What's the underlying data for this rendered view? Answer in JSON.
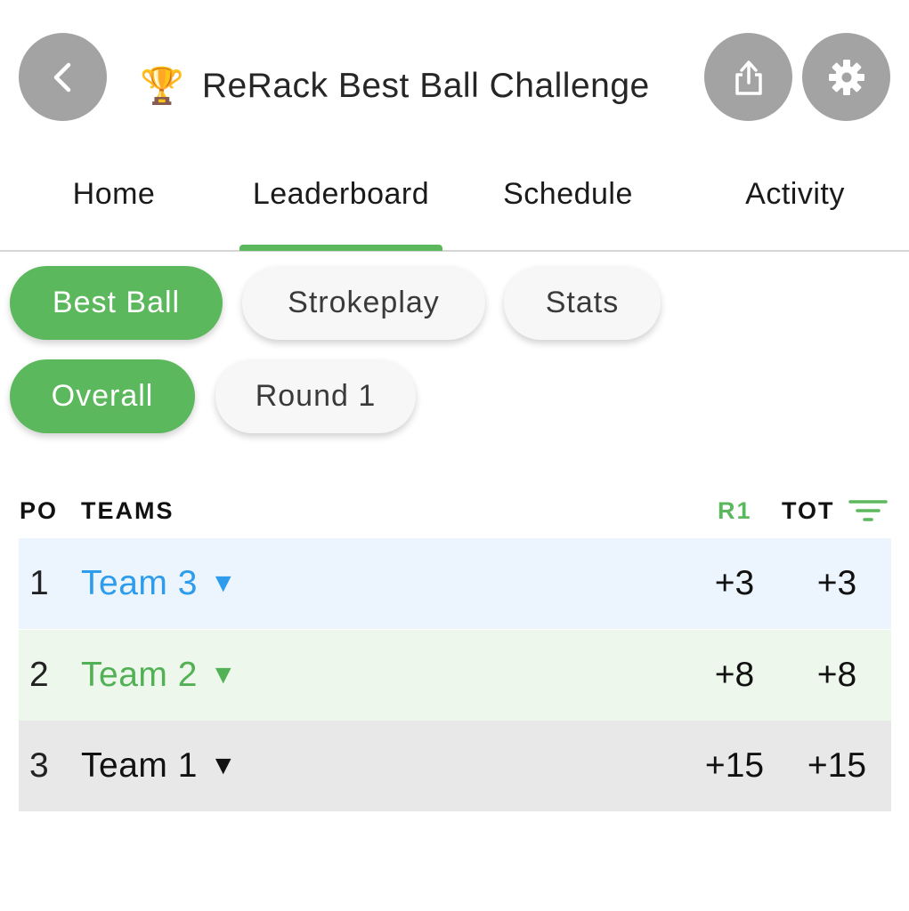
{
  "header": {
    "title": "ReRack Best Ball Challenge",
    "trophy_glyph": "🏆",
    "back_icon": "chevron-left-icon",
    "share_icon": "share-icon",
    "settings_icon": "gear-icon"
  },
  "tabs": [
    {
      "label": "Home",
      "active": false
    },
    {
      "label": "Leaderboard",
      "active": true
    },
    {
      "label": "Schedule",
      "active": false
    },
    {
      "label": "Activity",
      "active": false
    }
  ],
  "format_chips": [
    {
      "label": "Best Ball",
      "active": true
    },
    {
      "label": "Strokeplay",
      "active": false
    },
    {
      "label": "Stats",
      "active": false
    }
  ],
  "round_chips": [
    {
      "label": "Overall",
      "active": true
    },
    {
      "label": "Round 1",
      "active": false
    }
  ],
  "table": {
    "headers": {
      "position": "PO",
      "teams": "TEAMS",
      "round": "R1",
      "total": "TOT"
    },
    "rows": [
      {
        "position": "1",
        "team": "Team 3",
        "indicator": "▼",
        "r1": "+3",
        "total": "+3",
        "team_color": "#2d9cec",
        "row_color": "#ecf4fd"
      },
      {
        "position": "2",
        "team": "Team 2",
        "indicator": "▼",
        "r1": "+8",
        "total": "+8",
        "team_color": "#52b154",
        "row_color": "#edf7ec"
      },
      {
        "position": "3",
        "team": "Team 1",
        "indicator": "▼",
        "r1": "+15",
        "total": "+15",
        "team_color": "#111111",
        "row_color": "#e8e8e8"
      }
    ]
  },
  "colors": {
    "accent": "#5cb85c",
    "button_gray": "#a3a3a3"
  }
}
